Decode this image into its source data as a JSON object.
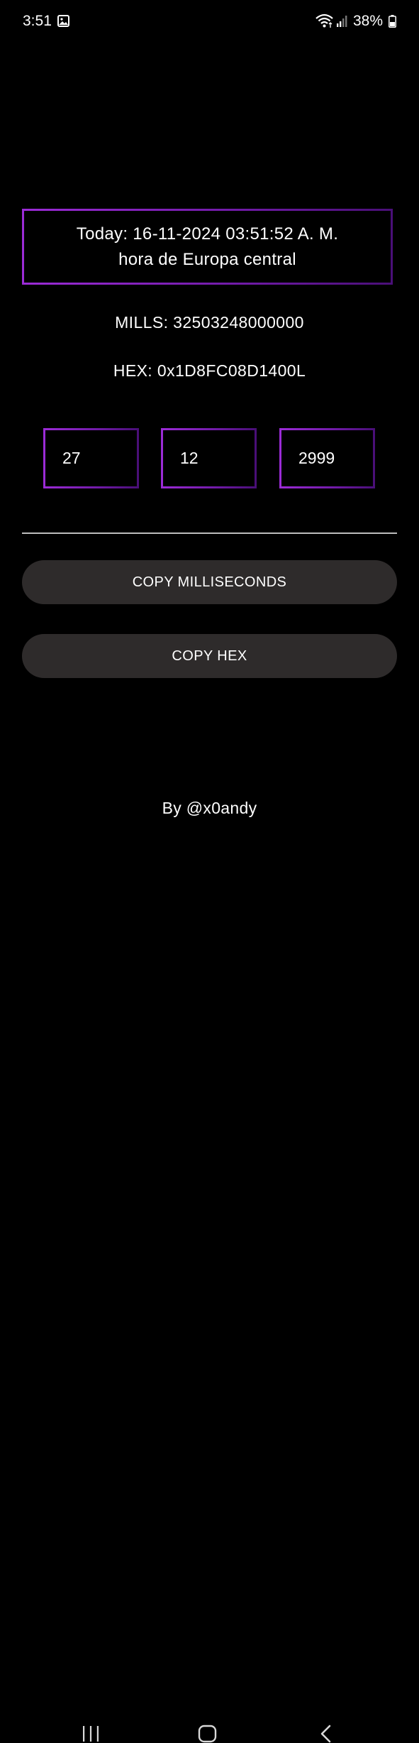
{
  "status_bar": {
    "time": "3:51",
    "battery": "38%"
  },
  "date_box": {
    "line1": "Today: 16-11-2024 03:51:52 A. M.",
    "line2": "hora de Europa central"
  },
  "mills": "MILLS: 32503248000000",
  "hex": "HEX: 0x1D8FC08D1400L",
  "inputs": {
    "day": "27",
    "month": "12",
    "year": "2999"
  },
  "buttons": {
    "copy_ms": "COPY MILLISECONDS",
    "copy_hex": "COPY HEX"
  },
  "author": "By @x0andy",
  "colors": {
    "accent": "#8e24c8",
    "button_bg": "#2e2b2b",
    "background": "#000000"
  },
  "icons": {
    "gallery": "image-icon",
    "wifi": "wifi-icon",
    "signal": "signal-icon",
    "battery": "battery-icon",
    "recents": "recents-icon",
    "home": "home-icon",
    "back": "back-icon"
  }
}
